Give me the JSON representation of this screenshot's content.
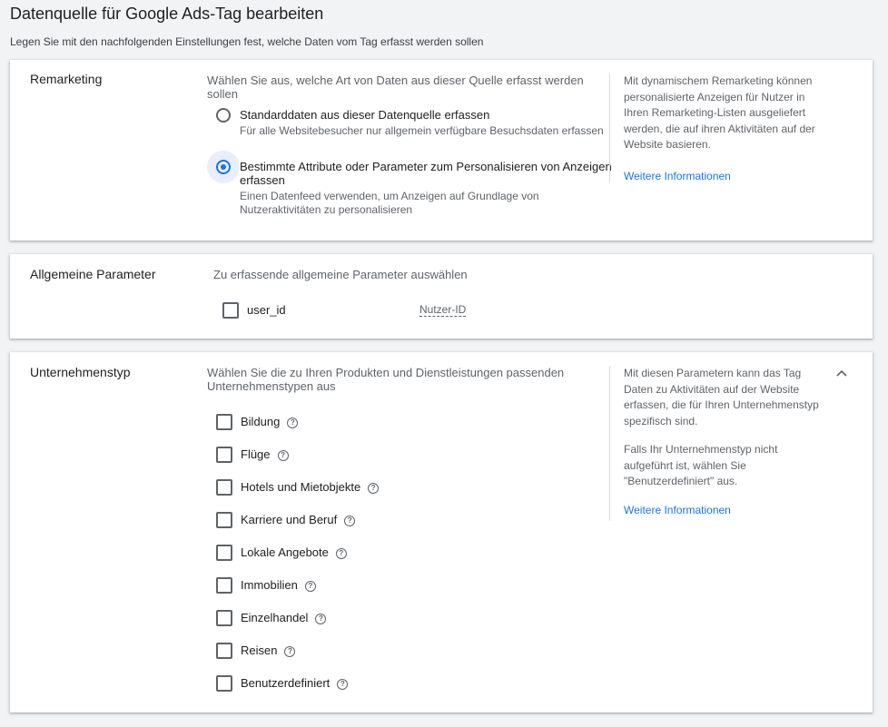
{
  "header": {
    "title": "Datenquelle für Google Ads-Tag bearbeiten",
    "subtitle": "Legen Sie mit den nachfolgenden Einstellungen fest, welche Daten vom Tag erfasst werden sollen"
  },
  "remarketing": {
    "label": "Remarketing",
    "hint": "Wählen Sie aus, welche Art von Daten aus dieser Quelle erfasst werden sollen",
    "options": [
      {
        "title": "Standarddaten aus dieser Datenquelle erfassen",
        "description": "Für alle Websitebesucher nur allgemein verfügbare Besuchsdaten erfassen",
        "selected": false
      },
      {
        "title": "Bestimmte Attribute oder Parameter zum Personalisieren von Anzeigen erfassen",
        "description": "Einen Datenfeed verwenden, um Anzeigen auf Grundlage von Nutzeraktivitäten zu personalisieren",
        "selected": true
      }
    ],
    "side_text": "Mit dynamischem Remarketing können personalisierte Anzeigen für Nutzer in Ihren Remarketing-Listen ausgeliefert werden, die auf ihren Aktivitäten auf der Website basieren.",
    "side_link": "Weitere Informationen"
  },
  "general_params": {
    "label": "Allgemeine Parameter",
    "hint": "Zu erfassende allgemeine Parameter auswählen",
    "param_name": "user_id",
    "param_desc": "Nutzer-ID"
  },
  "business_type": {
    "label": "Unternehmenstyp",
    "hint": "Wählen Sie die zu Ihren Produkten und Dienstleistungen passenden Unternehmenstypen aus",
    "options": [
      "Bildung",
      "Flüge",
      "Hotels und Mietobjekte",
      "Karriere und Beruf",
      "Lokale Angebote",
      "Immobilien",
      "Einzelhandel",
      "Reisen",
      "Benutzerdefiniert"
    ],
    "side_text_1": "Mit diesen Parametern kann das Tag Daten zu Aktivitäten auf der Website erfassen, die für Ihren Unternehmenstyp spezifisch sind.",
    "side_text_2": "Falls Ihr Unternehmenstyp nicht aufgeführt ist, wählen Sie \"Benutzerdefiniert\" aus.",
    "side_link": "Weitere Informationen"
  },
  "icons": {
    "help": "?",
    "collapse": "chevron-up-icon"
  },
  "colors": {
    "accent": "#1a73e8",
    "background": "#f1f3f4"
  }
}
